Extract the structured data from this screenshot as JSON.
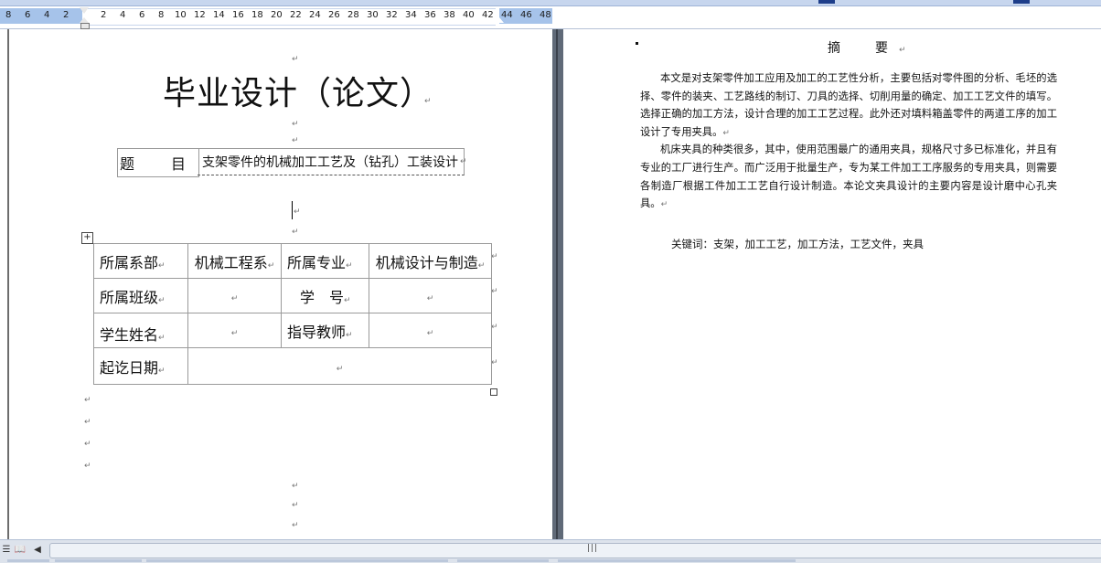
{
  "ruler": {
    "left_numbers": [
      "8",
      "6",
      "4",
      "2"
    ],
    "numbers": [
      "2",
      "4",
      "6",
      "8",
      "10",
      "12",
      "14",
      "16",
      "18",
      "20",
      "22",
      "24",
      "26",
      "28",
      "30",
      "32",
      "34",
      "36",
      "38",
      "40",
      "42",
      "44",
      "46",
      "48"
    ]
  },
  "document": {
    "title": "毕业设计（论文）",
    "topic_label": "题　目",
    "topic_value": "支架零件的机械加工工艺及（钻孔）工装设计",
    "table": [
      [
        "所属系部",
        "机械工程系",
        "所属专业",
        "机械设计与制造"
      ],
      [
        "所属班级",
        "",
        "学　号",
        ""
      ],
      [
        "学生姓名",
        "",
        "指导教师",
        ""
      ],
      [
        "起讫日期",
        ""
      ]
    ],
    "paragraph_mark": "↵"
  },
  "abstract": {
    "title": "摘　要",
    "paragraphs": [
      "本文是对支架零件加工应用及加工的工艺性分析，主要包括对零件图的分析、毛坯的选择、零件的装夹、工艺路线的制订、刀具的选择、切削用量的确定、加工工艺文件的填写。选择正确的加工方法，设计合理的加工工艺过程。此外还对填料箱盖零件的两道工序的加工设计了专用夹具。",
      "机床夹具的种类很多，其中，使用范围最广的通用夹具，规格尺寸多已标准化，并且有专业的工厂进行生产。而广泛用于批量生产，专为某工件加工工序服务的专用夹具，则需要各制造厂根据工件加工工艺自行设计制造。本论文夹具设计的主要内容是设计磨中心孔夹具。"
    ],
    "keywords": "关键词：支架，加工工艺，加工方法，工艺文件，夹具"
  },
  "statusbar": {
    "grip": "|||"
  }
}
